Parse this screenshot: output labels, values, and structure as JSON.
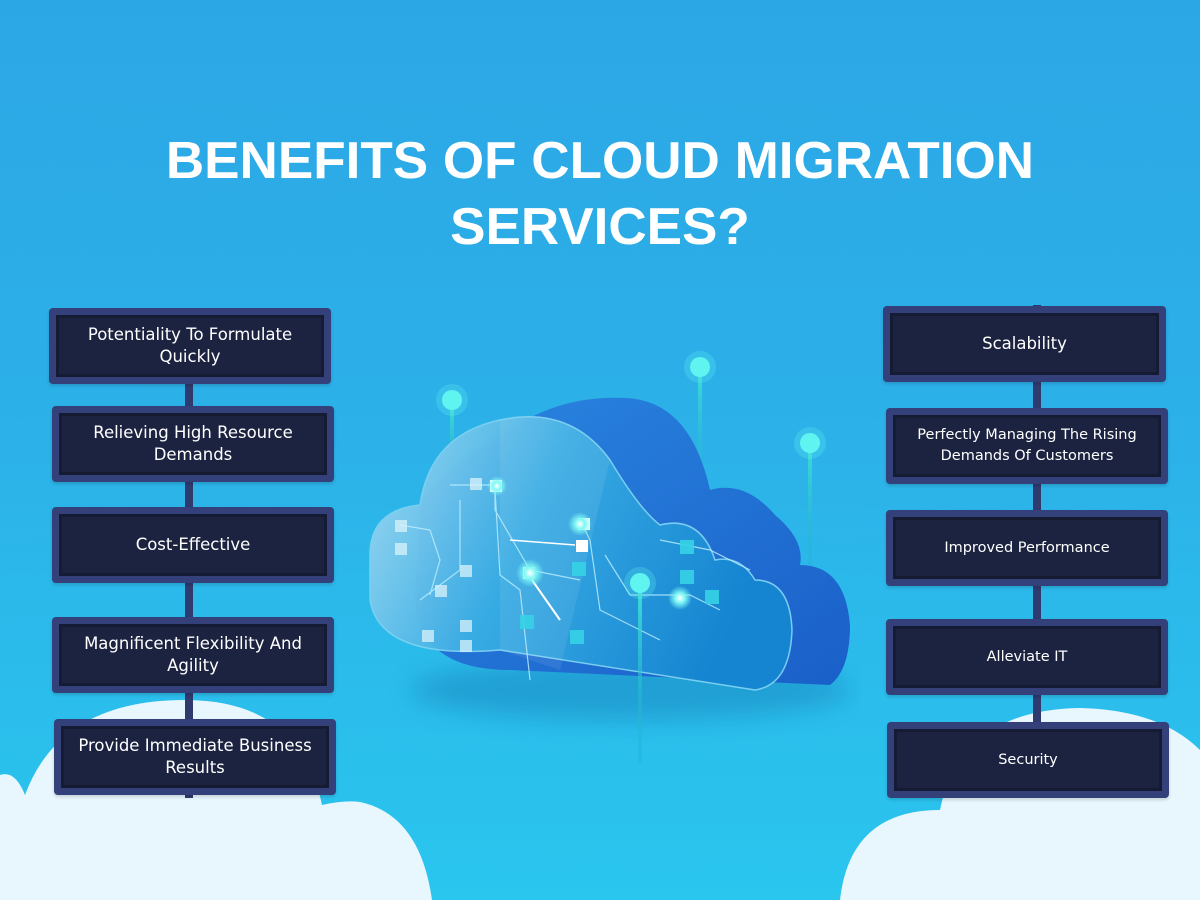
{
  "title": {
    "line1": "BENEFITS OF CLOUD MIGRATION",
    "line2": "SERVICES?"
  },
  "colors": {
    "background_top": "#2ca7e6",
    "background_bottom": "#2ac6ee",
    "card_frame": "#33407a",
    "card_fill": "#1c2340",
    "text": "#ffffff",
    "cloud_front": "#4fb8e8",
    "cloud_back": "#1f6fd6",
    "glow": "#5ff5f0",
    "bg_cloud": "#e8f7fd"
  },
  "left_benefits": [
    {
      "label": "Potentiality To Formulate Quickly"
    },
    {
      "label": "Relieving High Resource Demands"
    },
    {
      "label": "Cost-Effective"
    },
    {
      "label": "Magnificent Flexibility And Agility"
    },
    {
      "label": "Provide Immediate Business Results"
    }
  ],
  "right_benefits": [
    {
      "label": "Scalability"
    },
    {
      "label": "Perfectly Managing The Rising Demands Of Customers"
    },
    {
      "label": "Improved Performance"
    },
    {
      "label": "Alleviate IT"
    },
    {
      "label": "Security"
    }
  ],
  "illustration": {
    "icon": "cloud-circuit-icon"
  }
}
